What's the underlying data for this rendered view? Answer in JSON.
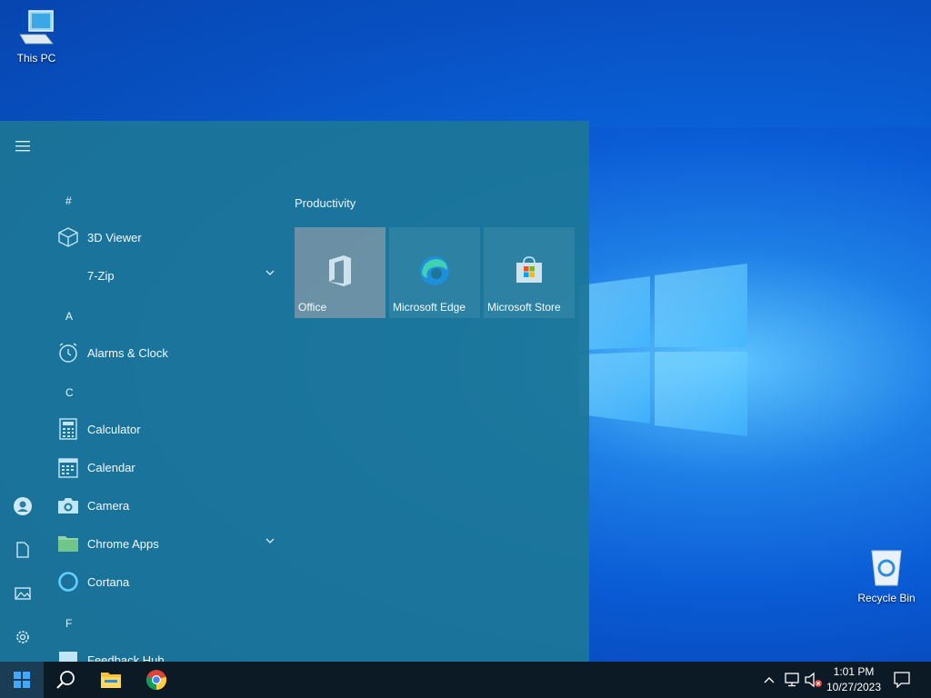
{
  "desktop": {
    "icons": [
      {
        "label": "This PC",
        "icon": "computer-icon"
      },
      {
        "label": "Recycle Bin",
        "icon": "recycle-bin-icon"
      }
    ]
  },
  "start_menu": {
    "rail": [
      "hamburger-menu-icon",
      "user-icon",
      "documents-icon",
      "pictures-icon",
      "settings-icon",
      "power-icon"
    ],
    "app_list": {
      "letters": [
        "#",
        "A",
        "C",
        "F"
      ],
      "apps": [
        {
          "name": "3D Viewer",
          "icon": "cube-icon"
        },
        {
          "name": "7-Zip",
          "icon": "",
          "expandable": true
        },
        {
          "name": "Alarms & Clock",
          "icon": "alarm-clock-icon"
        },
        {
          "name": "Calculator",
          "icon": "calculator-icon"
        },
        {
          "name": "Calendar",
          "icon": "calendar-icon"
        },
        {
          "name": "Camera",
          "icon": "camera-icon"
        },
        {
          "name": "Chrome Apps",
          "icon": "folder-icon",
          "expandable": true
        },
        {
          "name": "Cortana",
          "icon": "cortana-icon"
        },
        {
          "name": "Feedback Hub",
          "icon": "feedback-icon"
        }
      ]
    },
    "tiles": {
      "group_title": "Productivity",
      "items": [
        {
          "name": "Office",
          "icon": "office-icon"
        },
        {
          "name": "Microsoft Edge",
          "icon": "edge-icon"
        },
        {
          "name": "Microsoft Store",
          "icon": "store-icon"
        }
      ]
    }
  },
  "taskbar": {
    "items": [
      "start-button",
      "search-icon",
      "file-explorer-icon",
      "chrome-icon"
    ],
    "tray": [
      "show-hidden-icons",
      "network-icon",
      "volume-muted-icon"
    ],
    "time": "1:01 PM",
    "date": "10/27/2023",
    "notifications": "action-center-icon"
  },
  "colors": {
    "start_menu_bg": "#1c7698",
    "taskbar_bg": "#0c1a26",
    "accent": "#5fc6ff"
  }
}
